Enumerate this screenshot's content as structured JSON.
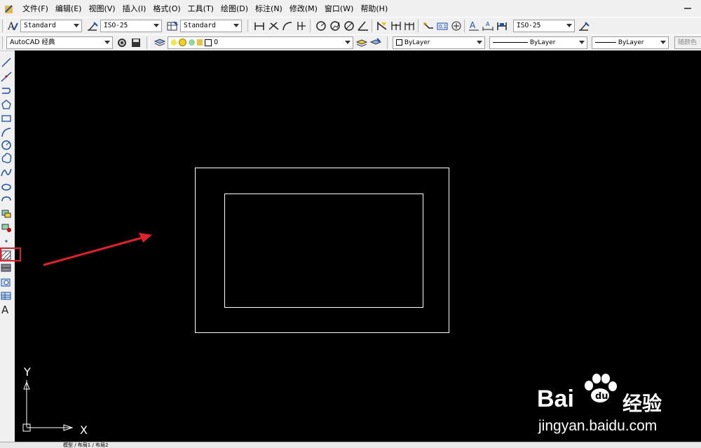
{
  "menu": {
    "items": [
      "文件(F)",
      "编辑(E)",
      "视图(V)",
      "插入(I)",
      "格式(O)",
      "工具(T)",
      "绘图(D)",
      "标注(N)",
      "修改(M)",
      "窗口(W)",
      "帮助(H)"
    ]
  },
  "toolbar1": {
    "text_style": "Standard",
    "dim_style": "ISO-25",
    "table_style": "Standard",
    "dim_style_right": "ISO-25"
  },
  "toolbar2": {
    "workspace": "AutoCAD 经典",
    "layer": "0",
    "color": "ByLayer",
    "linetype": "ByLayer",
    "lineweight": "ByLayer",
    "plot_style": "随颜色"
  },
  "ucs": {
    "y_label": "Y",
    "x_label": "X"
  },
  "watermark": {
    "brand": "Bai",
    "brand_suffix": "经验",
    "url": "jingyan.baidu.com"
  },
  "status": {
    "tabs": "模型 / 布局1 / 布局2"
  },
  "colors": {
    "canvas": "#000000",
    "highlight": "#e0202a",
    "arrow": "#e0202a"
  }
}
